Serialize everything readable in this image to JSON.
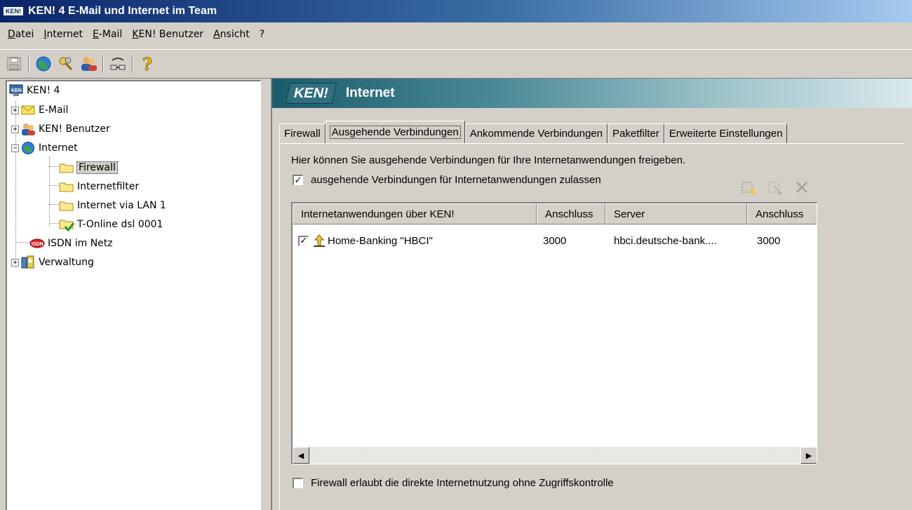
{
  "window": {
    "icon_text": "KEN!",
    "title": "KEN! 4   E-Mail und Internet im Team"
  },
  "menu": [
    "Datei",
    "Internet",
    "E-Mail",
    "KEN! Benutzer",
    "Ansicht",
    "?"
  ],
  "toolbar": {
    "buttons": [
      "save-icon",
      "internet-globe-icon",
      "keys-icon",
      "users-icon",
      "connection-icon",
      "help-icon"
    ]
  },
  "tree": {
    "root": "KEN! 4",
    "email": "E-Mail",
    "users": "KEN! Benutzer",
    "internet": "Internet",
    "firewall": "Firewall",
    "internetfilter": "Internetfilter",
    "lan": "Internet via LAN 1",
    "tonline": "T-Online dsl 0001",
    "isdn": "ISDN im Netz",
    "verwaltung": "Verwaltung"
  },
  "header": {
    "logo": "KEN!",
    "title": "Internet"
  },
  "tabs": [
    "Firewall",
    "Ausgehende Verbindungen",
    "Ankommende Verbindungen",
    "Paketfilter",
    "Erweiterte Einstellungen"
  ],
  "active_tab": "Ausgehende Verbindungen",
  "panel": {
    "description": "Hier können Sie ausgehende Verbindungen für Ihre Internetanwendungen freigeben.",
    "allow_checkbox_label": "ausgehende Verbindungen für Internetanwendungen zulassen",
    "allow_checked": true,
    "direct_checkbox_label": "Firewall erlaubt die direkte Internetnutzung ohne Zugriffskontrolle",
    "direct_checked": false
  },
  "list": {
    "columns": [
      "Internetanwendungen über KEN!",
      "Anschluss",
      "Server",
      "Anschluss"
    ],
    "rows": [
      {
        "checked": true,
        "name": "Home-Banking \"HBCI\"",
        "port": "3000",
        "server": "hbci.deutsche-bank....",
        "server_port": "3000"
      }
    ]
  },
  "colors": {
    "titlebar_start": "#0a246a",
    "header_teal": "#1b5c6b",
    "face": "#d4d0c8"
  }
}
